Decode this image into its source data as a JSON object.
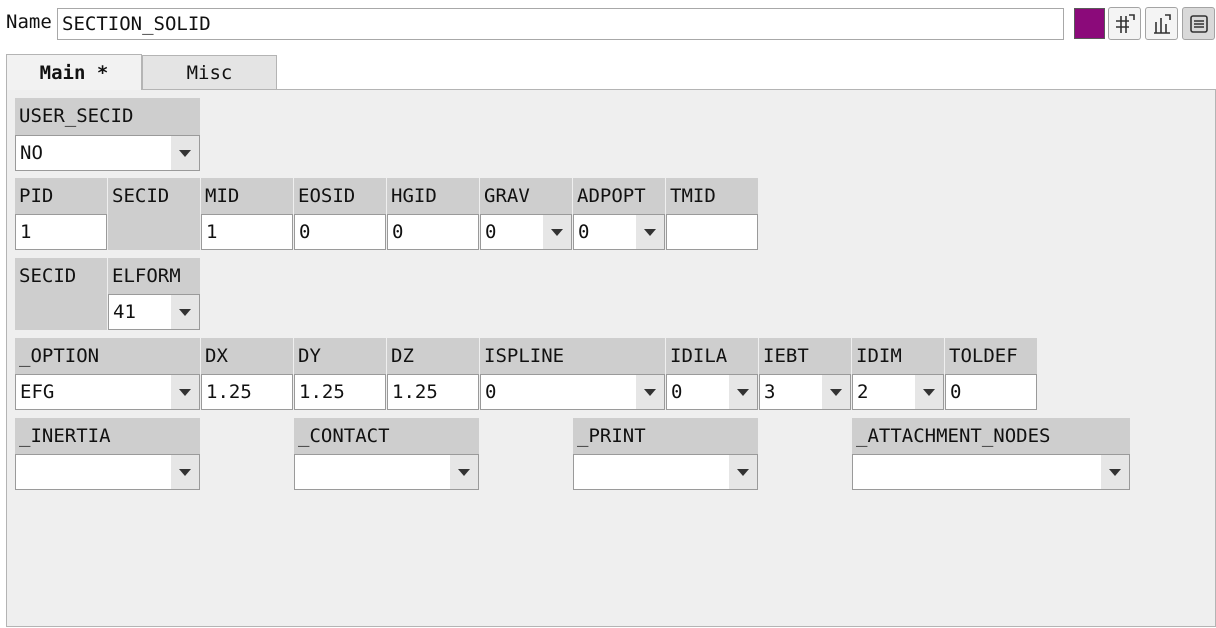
{
  "header": {
    "name_label": "Name",
    "name_value": "SECTION_SOLID",
    "color_swatch": "#8b0a7a"
  },
  "tabs": [
    {
      "label": "Main *",
      "active": true
    },
    {
      "label": "Misc",
      "active": false
    }
  ],
  "fields": {
    "user_secid": {
      "label": "USER_SECID",
      "value": "NO"
    },
    "pid": {
      "label": "PID",
      "value": "1"
    },
    "secid1": {
      "label": "SECID"
    },
    "mid": {
      "label": "MID",
      "value": "1"
    },
    "eosid": {
      "label": "EOSID",
      "value": "0"
    },
    "hgid": {
      "label": "HGID",
      "value": "0"
    },
    "grav": {
      "label": "GRAV",
      "value": "0"
    },
    "adpopt": {
      "label": "ADPOPT",
      "value": "0"
    },
    "tmid": {
      "label": "TMID",
      "value": ""
    },
    "secid2": {
      "label": "SECID"
    },
    "elform": {
      "label": "ELFORM",
      "value": "41"
    },
    "option": {
      "label": "_OPTION",
      "value": "EFG"
    },
    "dx": {
      "label": "DX",
      "value": "1.25"
    },
    "dy": {
      "label": "DY",
      "value": "1.25"
    },
    "dz": {
      "label": "DZ",
      "value": "1.25"
    },
    "ispline": {
      "label": "ISPLINE",
      "value": "0"
    },
    "idila": {
      "label": "IDILA",
      "value": "0"
    },
    "iebt": {
      "label": "IEBT",
      "value": "3"
    },
    "idim": {
      "label": "IDIM",
      "value": "2"
    },
    "toldef": {
      "label": "TOLDEF",
      "value": "0"
    },
    "inertia": {
      "label": "_INERTIA",
      "value": ""
    },
    "contact": {
      "label": "_CONTACT",
      "value": ""
    },
    "print": {
      "label": "_PRINT",
      "value": ""
    },
    "attachment_nodes": {
      "label": "_ATTACHMENT_NODES",
      "value": ""
    }
  }
}
